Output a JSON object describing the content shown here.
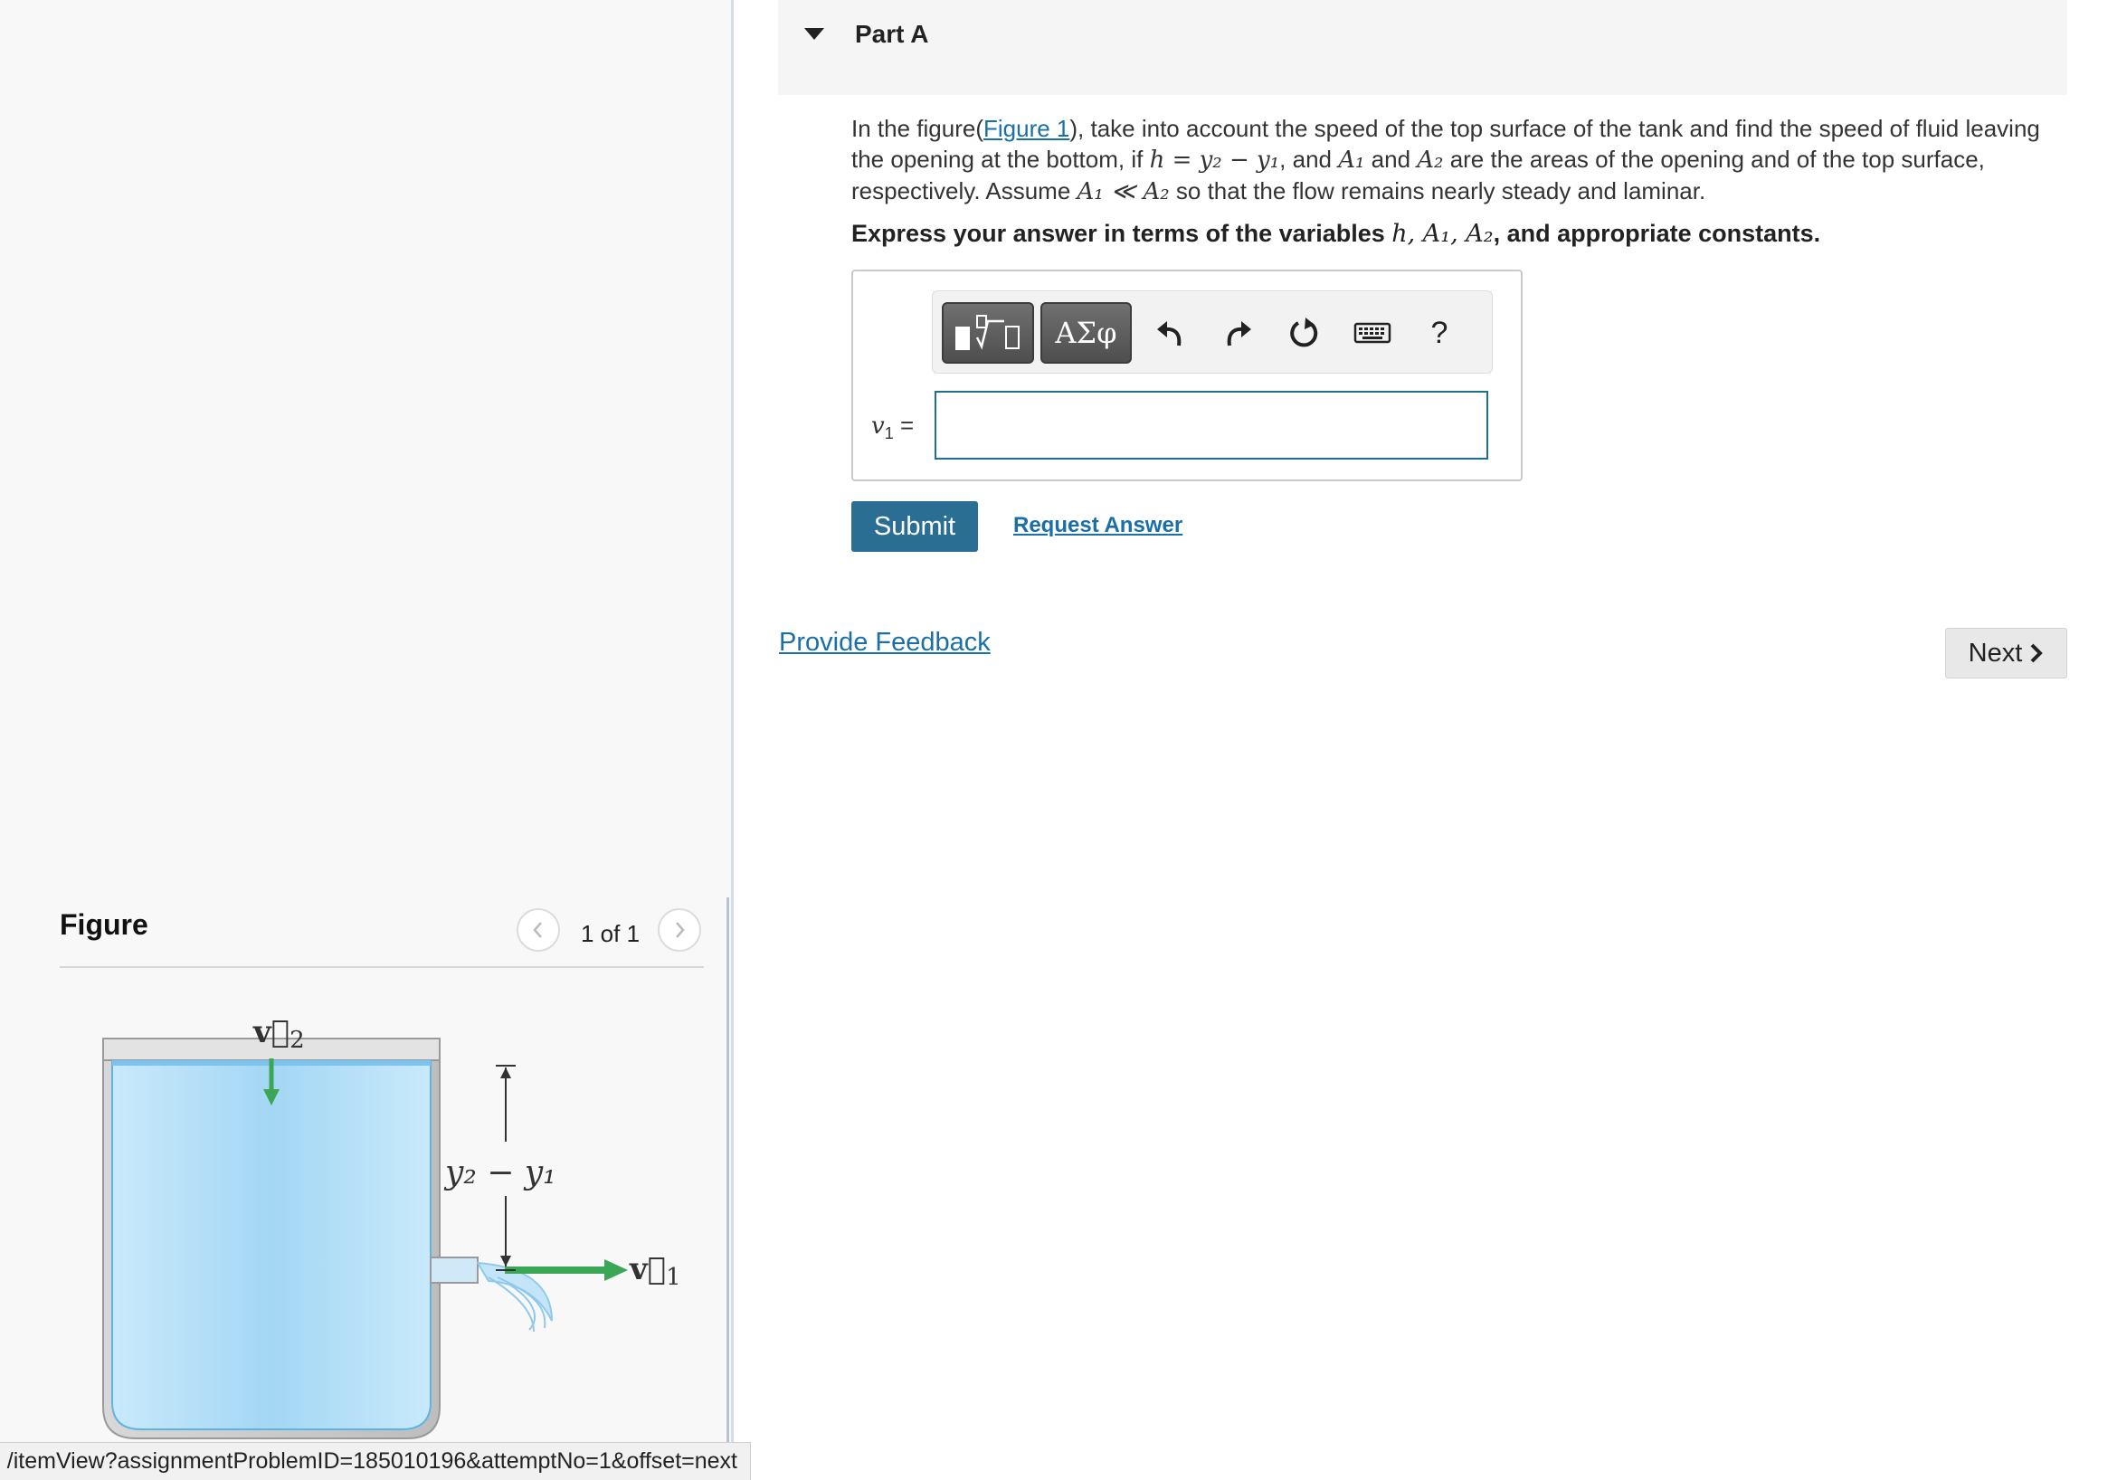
{
  "part": {
    "title": "Part A"
  },
  "question": {
    "intro": "In the figure(",
    "figure_link": "Figure 1",
    "text_1": "), take into account the speed of the top surface of the tank and find the speed of fluid leaving the opening at the bottom, if ",
    "eq_h": "h = y₂ − y₁",
    "text_2": ", and ",
    "A1": "A₁",
    "text_3": " and ",
    "A2": "A₂",
    "text_4": " are the areas of the opening and of the top surface, respectively. Assume ",
    "ineq": "A₁ ≪ A₂",
    "text_5": " so that the flow remains nearly steady and laminar."
  },
  "instruction": {
    "prefix": "Express your answer in terms of the variables ",
    "vars": "h, A₁, A₂",
    "suffix": ", and appropriate constants."
  },
  "toolbar": {
    "greek_label": "ΑΣφ",
    "help_label": "?",
    "icons": [
      "templates-icon",
      "undo-icon",
      "redo-icon",
      "reset-icon",
      "keyboard-icon",
      "help-icon"
    ]
  },
  "answer": {
    "label_var": "v",
    "label_sub": "1",
    "label_eq": " =",
    "value": ""
  },
  "actions": {
    "submit_label": "Submit",
    "request_answer_label": "Request Answer",
    "provide_feedback_label": "Provide Feedback",
    "next_label": "Next"
  },
  "figure": {
    "title": "Figure",
    "counter": "1 of 1",
    "labels": {
      "v2": "v⃗",
      "v2_sub": "2",
      "v1": "v⃗",
      "v1_sub": "1",
      "height": "y₂ − y₁"
    }
  },
  "status_bar": {
    "url": "/itemView?assignmentProblemID=185010196&attemptNo=1&offset=next"
  },
  "colors": {
    "accent_link": "#1a6fa8",
    "submit_bg": "#2b6e94",
    "input_border": "#1f6f8f",
    "arrow_green": "#3aa656",
    "water_blue": "#a9daf5"
  }
}
